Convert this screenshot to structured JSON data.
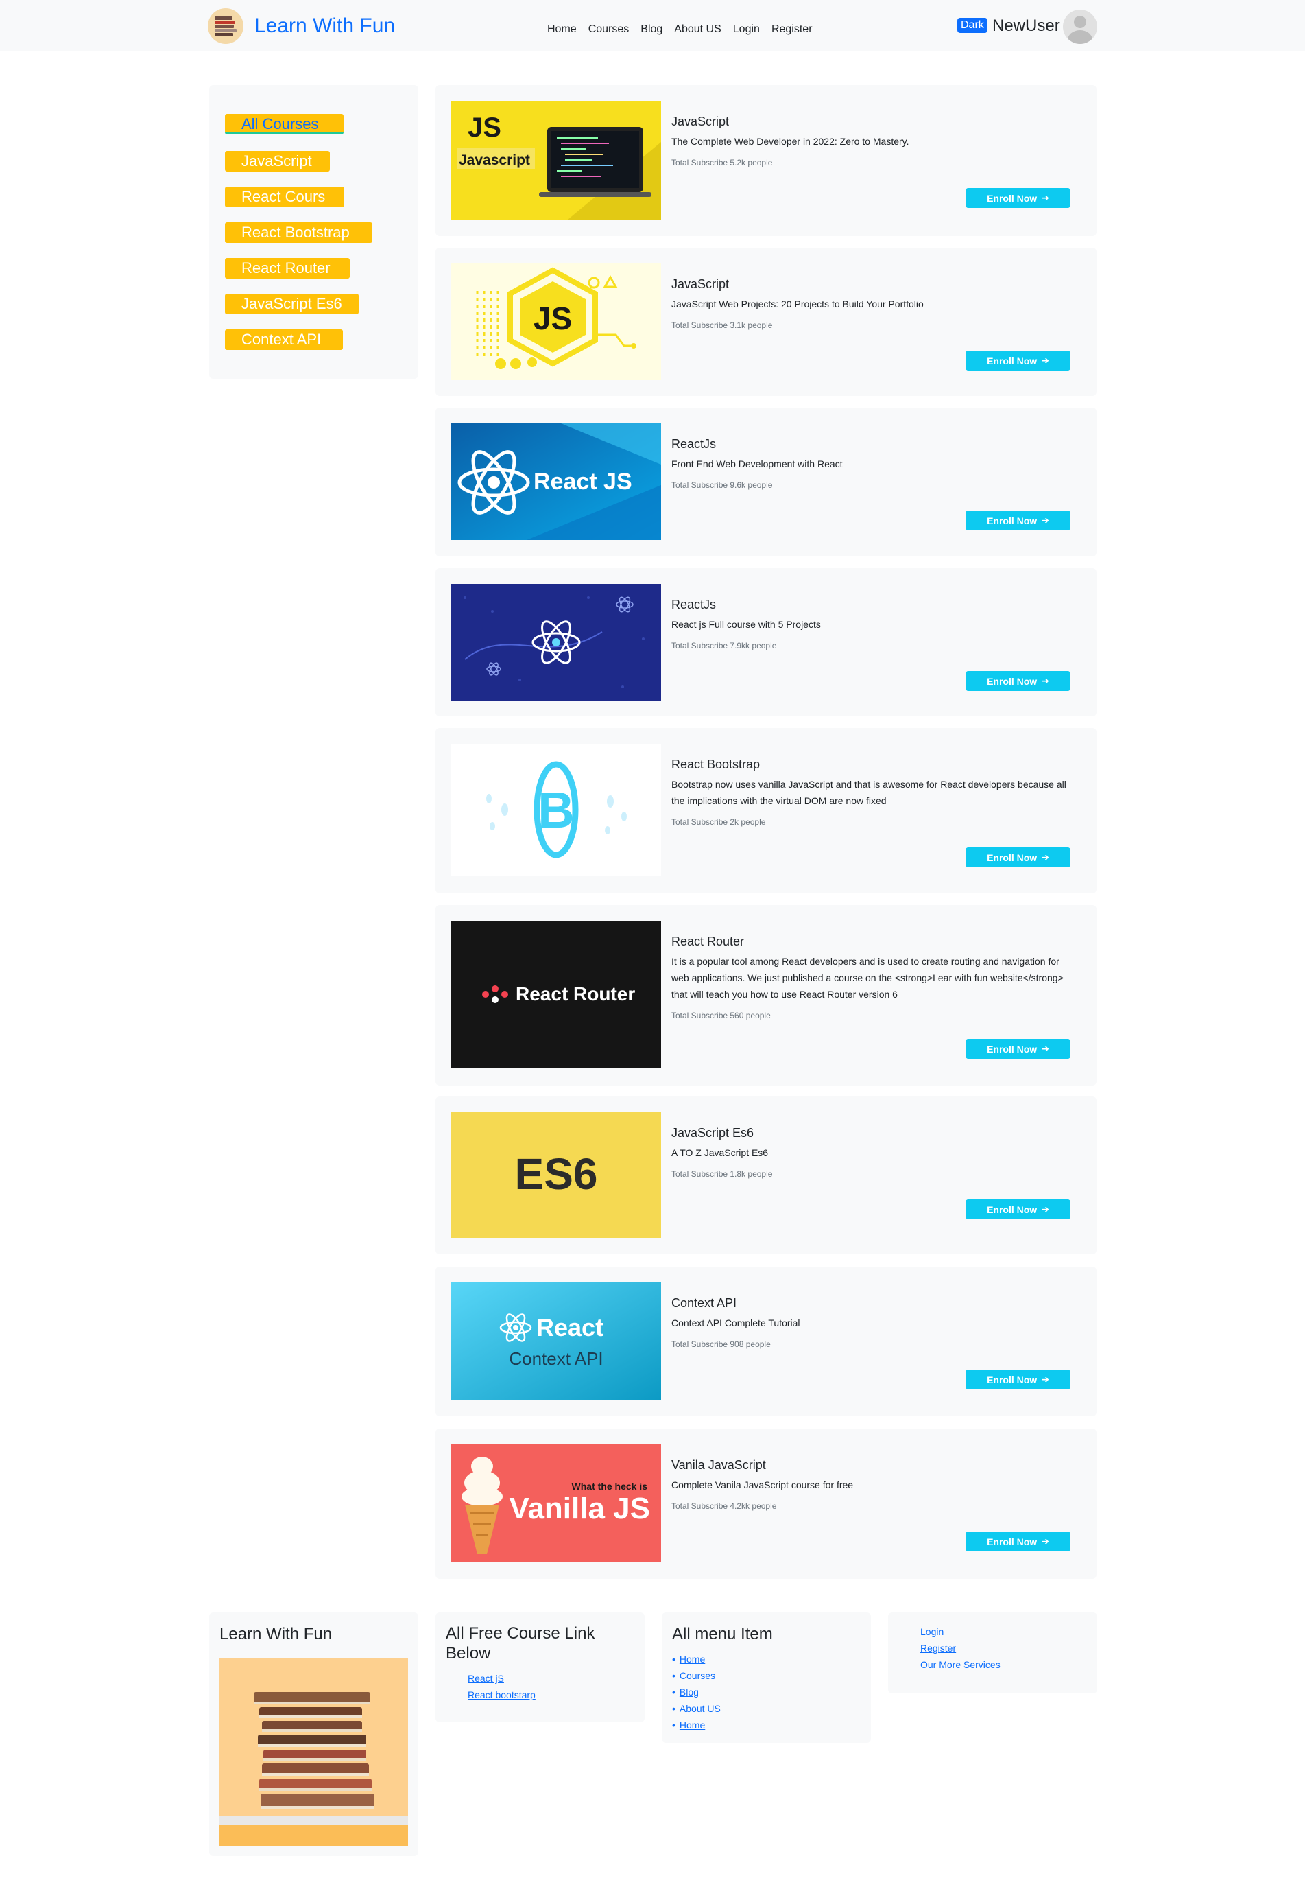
{
  "navbar": {
    "brand": "Learn With Fun",
    "links": [
      "Home",
      "Courses",
      "Blog",
      "About US",
      "Login",
      "Register"
    ],
    "theme_badge": "Dark",
    "username": "NewUser"
  },
  "sidebar": {
    "categories": [
      "All Courses",
      "JavaScript",
      "React Cours",
      "React Bootstrap",
      "React Router",
      "JavaScript Es6",
      "Context API"
    ]
  },
  "courses": [
    {
      "title": "JavaScript",
      "desc": "The Complete Web Developer in 2022: Zero to Mastery.",
      "subs": "Total Subscribe 5.2k people",
      "enroll": "Enroll Now",
      "img_text": [
        "JS",
        "Javascript"
      ]
    },
    {
      "title": "JavaScript",
      "desc": "JavaScript Web Projects: 20 Projects to Build Your Portfolio",
      "subs": "Total Subscribe 3.1k people",
      "enroll": "Enroll Now",
      "img_text": [
        "JS"
      ]
    },
    {
      "title": "ReactJs",
      "desc": "Front End Web Development with React",
      "subs": "Total Subscribe 9.6k people",
      "enroll": "Enroll Now",
      "img_text": [
        "React JS"
      ]
    },
    {
      "title": "ReactJs",
      "desc": "React js Full course with 5 Projects",
      "subs": "Total Subscribe 7.9kk people",
      "enroll": "Enroll Now"
    },
    {
      "title": "React Bootstrap",
      "desc": "Bootstrap now uses vanilla JavaScript and that is awesome for React developers because all the implications with the virtual DOM are now fixed",
      "subs": "Total Subscribe 2k people",
      "enroll": "Enroll Now"
    },
    {
      "title": "React Router",
      "desc": "It is a popular tool among React developers and is used to create routing and navigation for web applications. We just published a course on the <strong>Lear with fun website</strong> that will teach you how to use React Router version 6",
      "subs": "Total Subscribe 560 people",
      "enroll": "Enroll Now",
      "img_text": [
        "React Router"
      ]
    },
    {
      "title": "JavaScript Es6",
      "desc": "A TO Z JavaScript Es6",
      "subs": "Total Subscribe 1.8k people",
      "enroll": "Enroll Now",
      "img_text": [
        "ES6"
      ]
    },
    {
      "title": "Context API",
      "desc": "Context API Complete Tutorial",
      "subs": "Total Subscribe 908 people",
      "enroll": "Enroll Now",
      "img_text": [
        "React",
        "Context API"
      ]
    },
    {
      "title": "Vanila JavaScript",
      "desc": "Complete Vanila JavaScript course for free",
      "subs": "Total Subscribe 4.2kk people",
      "enroll": "Enroll Now",
      "img_text": [
        "What the heck is",
        "Vanilla JS"
      ]
    }
  ],
  "footer": {
    "brand": "Learn With Fun",
    "free_links_title": "All Free Course Link Below",
    "free_links": [
      "React jS",
      "React bootstarp"
    ],
    "menu_title": "All menu Item",
    "menu_items": [
      "Home",
      "Courses",
      "Blog",
      "About US",
      "Home"
    ],
    "account_links": [
      "Login",
      "Register",
      "Our More Services"
    ]
  },
  "colors": {
    "brand_blue": "#0d6efd",
    "category_yellow": "#ffc107",
    "enroll_cyan": "#0dcaf0",
    "panel_gray": "#f8f9fa"
  }
}
